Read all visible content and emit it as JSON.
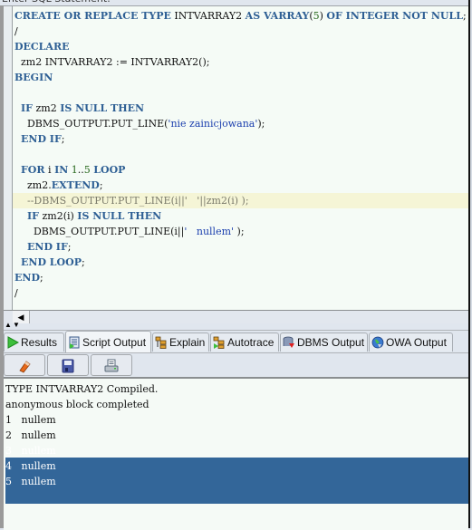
{
  "header": {
    "title": "Enter SQL Statement:"
  },
  "editor": {
    "lines": [
      [
        {
          "t": "CREATE OR REPLACE TYPE",
          "c": "kw"
        },
        {
          "t": " INTVARRAY2 "
        },
        {
          "t": "AS VARRAY",
          "c": "kw"
        },
        {
          "t": "("
        },
        {
          "t": "5",
          "c": "num"
        },
        {
          "t": ") "
        },
        {
          "t": "OF INTEGER NOT NULL",
          "c": "kw"
        },
        {
          "t": ";"
        }
      ],
      [
        {
          "t": "/"
        }
      ],
      [
        {
          "t": "DECLARE",
          "c": "kw"
        }
      ],
      [
        {
          "t": "  zm2 INTVARRAY2 := INTVARRAY2();"
        }
      ],
      [
        {
          "t": "BEGIN",
          "c": "kw"
        }
      ],
      [
        {
          "t": ""
        }
      ],
      [
        {
          "t": "  "
        },
        {
          "t": "IF",
          "c": "kw"
        },
        {
          "t": " zm2 "
        },
        {
          "t": "IS NULL THEN",
          "c": "kw"
        }
      ],
      [
        {
          "t": "    DBMS_OUTPUT.PUT_LINE("
        },
        {
          "t": "'nie zainicjowana'",
          "c": "str"
        },
        {
          "t": ");"
        }
      ],
      [
        {
          "t": "  "
        },
        {
          "t": "END IF",
          "c": "kw"
        },
        {
          "t": ";"
        }
      ],
      [
        {
          "t": ""
        }
      ],
      [
        {
          "t": "  "
        },
        {
          "t": "FOR",
          "c": "kw"
        },
        {
          "t": " i "
        },
        {
          "t": "IN",
          "c": "kw"
        },
        {
          "t": " "
        },
        {
          "t": "1",
          "c": "num"
        },
        {
          "t": ".."
        },
        {
          "t": "5",
          "c": "num"
        },
        {
          "t": " "
        },
        {
          "t": "LOOP",
          "c": "kw"
        }
      ],
      [
        {
          "t": "    zm2."
        },
        {
          "t": "EXTEND",
          "c": "kw"
        },
        {
          "t": ";"
        }
      ],
      [
        {
          "t": "    --DBMS_OUTPUT.PUT_LINE(i||'   '||zm2(i) );",
          "c": "cmt"
        }
      ],
      [
        {
          "t": "    "
        },
        {
          "t": "IF",
          "c": "kw"
        },
        {
          "t": " zm2(i) "
        },
        {
          "t": "IS NULL THEN",
          "c": "kw"
        }
      ],
      [
        {
          "t": "      DBMS_OUTPUT.PUT_LINE(i||"
        },
        {
          "t": "'   nullem'",
          "c": "str"
        },
        {
          "t": " );"
        }
      ],
      [
        {
          "t": "    "
        },
        {
          "t": "END IF",
          "c": "kw"
        },
        {
          "t": ";"
        }
      ],
      [
        {
          "t": "  "
        },
        {
          "t": "END LOOP",
          "c": "kw"
        },
        {
          "t": ";"
        }
      ],
      [
        {
          "t": "END",
          "c": "kw"
        },
        {
          "t": ";"
        }
      ],
      [
        {
          "t": "/"
        }
      ]
    ],
    "highlighted_line": 12
  },
  "tabs": [
    {
      "label": "Results",
      "icon": "run-icon",
      "active": false
    },
    {
      "label": "Script Output",
      "icon": "script-output-icon",
      "active": true
    },
    {
      "label": "Explain",
      "icon": "explain-plan-icon",
      "active": false
    },
    {
      "label": "Autotrace",
      "icon": "autotrace-icon",
      "active": false
    },
    {
      "label": "DBMS Output",
      "icon": "dbms-output-icon",
      "active": false
    },
    {
      "label": "OWA Output",
      "icon": "owa-globe-icon",
      "active": false
    }
  ],
  "toolbar": {
    "buttons": [
      {
        "name": "clear",
        "icon": "eraser-icon"
      },
      {
        "name": "save",
        "icon": "floppy-save-icon"
      },
      {
        "name": "print",
        "icon": "printer-icon"
      }
    ]
  },
  "output": {
    "lines": [
      "TYPE INTVARRAY2 Compiled.",
      "anonymous block completed",
      "1   nullem",
      "2   nullem",
      "3   nullem",
      "4   nullem",
      "5   nullem"
    ],
    "selection_start_line": 5
  },
  "colors": {
    "keyword": "#2e5f94",
    "string": "#1b3fae",
    "number": "#2a6a1f",
    "comment": "#7a7a6a",
    "selection": "#336699",
    "current_line": "#f5f5d6",
    "editor_bg": "#f5fbf6"
  }
}
